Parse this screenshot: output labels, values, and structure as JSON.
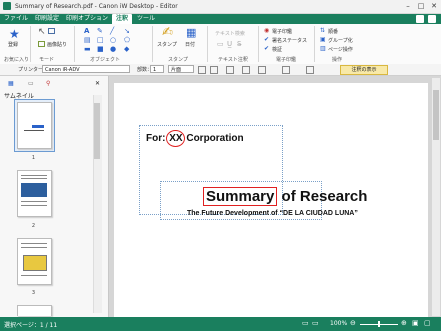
{
  "window": {
    "title": "Summary of Research.pdf - Canon iW Desktop - Editor"
  },
  "tabs": [
    {
      "label": "ファイル"
    },
    {
      "label": "印刷設定"
    },
    {
      "label": "印刷オプション"
    },
    {
      "label": "注釈"
    },
    {
      "label": "ツール"
    }
  ],
  "ribbon": {
    "groups": {
      "favorites": "お気に入り",
      "mode": "モード",
      "object": "オブジェクト",
      "stamp": "スタンプ",
      "text_annotation": "テキスト注釈",
      "digital_signature": "電子印鑑",
      "operation": "操作"
    },
    "buttons": {
      "register": "登録",
      "image_paste": "画像貼り",
      "stamp": "スタンプ",
      "date": "日付",
      "text_search": "テキスト検索",
      "digital_seal": "電子印鑑",
      "sign_status": "署名ステータス",
      "verify": "検証",
      "sort": "順番",
      "group": "グループ化",
      "page_operation": "ページ操作"
    }
  },
  "subbar": {
    "printer_label": "プリンター：",
    "printer_value": "Canon iR-ADV",
    "copies_label": "部数：",
    "copies_value": "1",
    "duplex_value": "片面",
    "show_annotations": "注釈の表示"
  },
  "left_pane": {
    "label": "サムネイル",
    "thumbnails": [
      {
        "num": "1"
      },
      {
        "num": "2"
      },
      {
        "num": "3"
      }
    ]
  },
  "document": {
    "for_prefix": "For: ",
    "for_highlight": "XX",
    "for_suffix": " Corporation",
    "title_highlight": "Summary",
    "title_rest": " of Research",
    "subtitle": "The Future Development of “DE LA CIUDAD LUNA”"
  },
  "status": {
    "selected_pages": "選択ページ：1 / 11",
    "zoom": "100%"
  },
  "colors": {
    "accent": "#1a7f5e",
    "annotation_red": "#e02020"
  }
}
